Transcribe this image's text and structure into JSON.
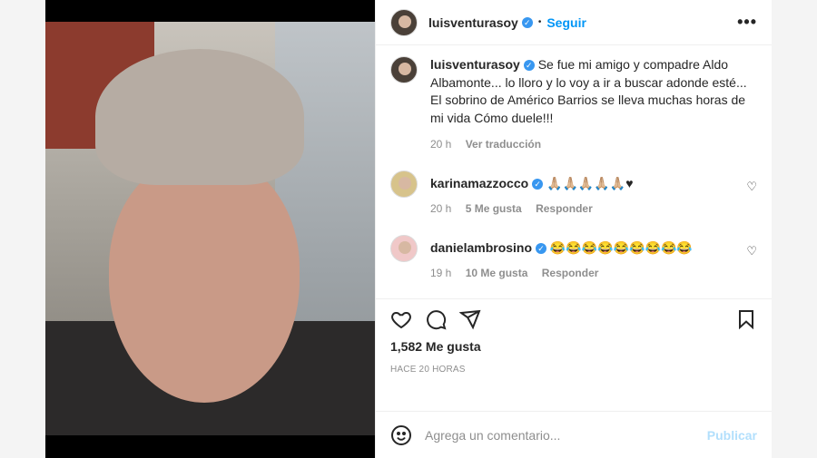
{
  "post": {
    "username": "luisventurasoy",
    "follow_label": "Seguir",
    "more_label": "•••",
    "caption": "Se fue mi amigo y compadre Aldo Albamonte... lo lloro y lo voy a ir a buscar adonde esté... El sobrino de Américo Barrios se lleva muchas horas de mi vida Cómo duele!!!",
    "caption_time": "20 h",
    "translate_label": "Ver traducción"
  },
  "comments": [
    {
      "username": "karinamazzocco",
      "text": "🙏🏼🙏🏼🙏🏼🙏🏼🙏🏼♥",
      "time": "20 h",
      "likes": "5 Me gusta",
      "reply_label": "Responder"
    },
    {
      "username": "danielambrosino",
      "text": "😂😂😂😂😂😂😂😂😂",
      "time": "19 h",
      "likes": "10 Me gusta",
      "reply_label": "Responder"
    }
  ],
  "stats": {
    "likes": "1,582 Me gusta",
    "posted": "HACE 20 HORAS"
  },
  "add_comment": {
    "placeholder": "Agrega un comentario...",
    "publish_label": "Publicar"
  },
  "icons": {
    "heart": "heart-icon",
    "comment": "comment-icon",
    "share": "share-icon",
    "bookmark": "bookmark-icon",
    "emoji": "emoji-icon",
    "verified": "verified-badge-icon"
  },
  "colors": {
    "link_blue": "#0095f6",
    "publish_disabled": "#b2dffc",
    "verified_blue": "#3897f0"
  }
}
